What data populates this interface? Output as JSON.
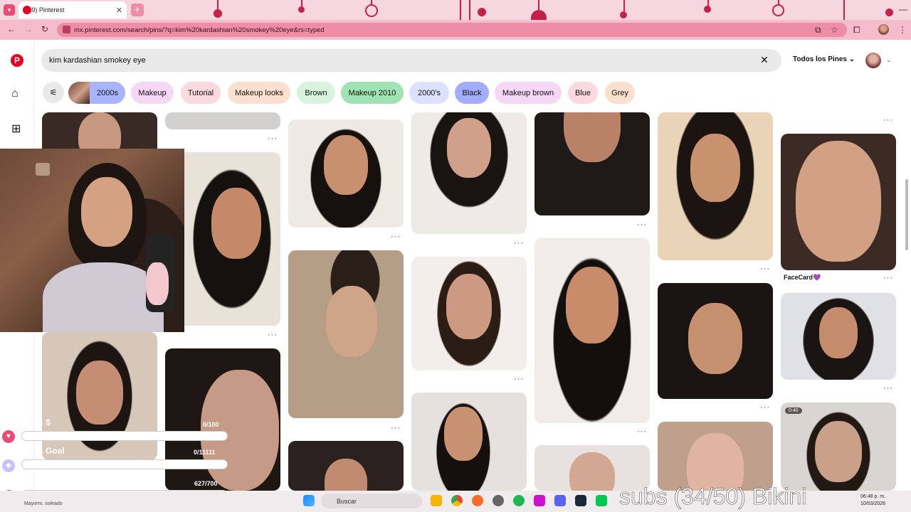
{
  "browser": {
    "tab_title": "(119) Pinterest",
    "url": "mx.pinterest.com/search/pins/?q=kim%20kardashian%20smokey%20eye&rs=typed"
  },
  "search": {
    "query": "kim kardashian smokey eye",
    "filter_label": "Todos los Pines"
  },
  "chips": [
    {
      "label": "2000s",
      "color": "#a9b4ff"
    },
    {
      "label": "Makeup",
      "color": "#f6d7f6"
    },
    {
      "label": "Tutorial",
      "color": "#fbd9de"
    },
    {
      "label": "Makeup looks",
      "color": "#fbe0cf"
    },
    {
      "label": "Brown",
      "color": "#d8f4df"
    },
    {
      "label": "Makeup 2010",
      "color": "#9ee3b1"
    },
    {
      "label": "2000's",
      "color": "#dbe1ff"
    },
    {
      "label": "Black",
      "color": "#a3acff"
    },
    {
      "label": "Makeup brown",
      "color": "#f6d7f6"
    },
    {
      "label": "Blue",
      "color": "#fbd9de"
    },
    {
      "label": "Grey",
      "color": "#fbe0cf"
    }
  ],
  "pins": {
    "facecard_title": "FaceCard💜",
    "video_duration": "0:40",
    "more_label": "···"
  },
  "overlay": {
    "goal1_label": "This $",
    "goal1_count": "0/100",
    "goal1_fraction": 0,
    "goal2_label": "This Goal",
    "goal2_count": "0/11111",
    "goal2_fraction": 0,
    "goal3_count": "627/700",
    "goal3_fraction": 0.8957
  },
  "taskbar": {
    "search_label": "Buscar",
    "weather": "Mayorm. soleado",
    "subs_text": "subs (34/50) Bikini",
    "time": "06:48 p. m.",
    "date": "10/03/2026"
  }
}
